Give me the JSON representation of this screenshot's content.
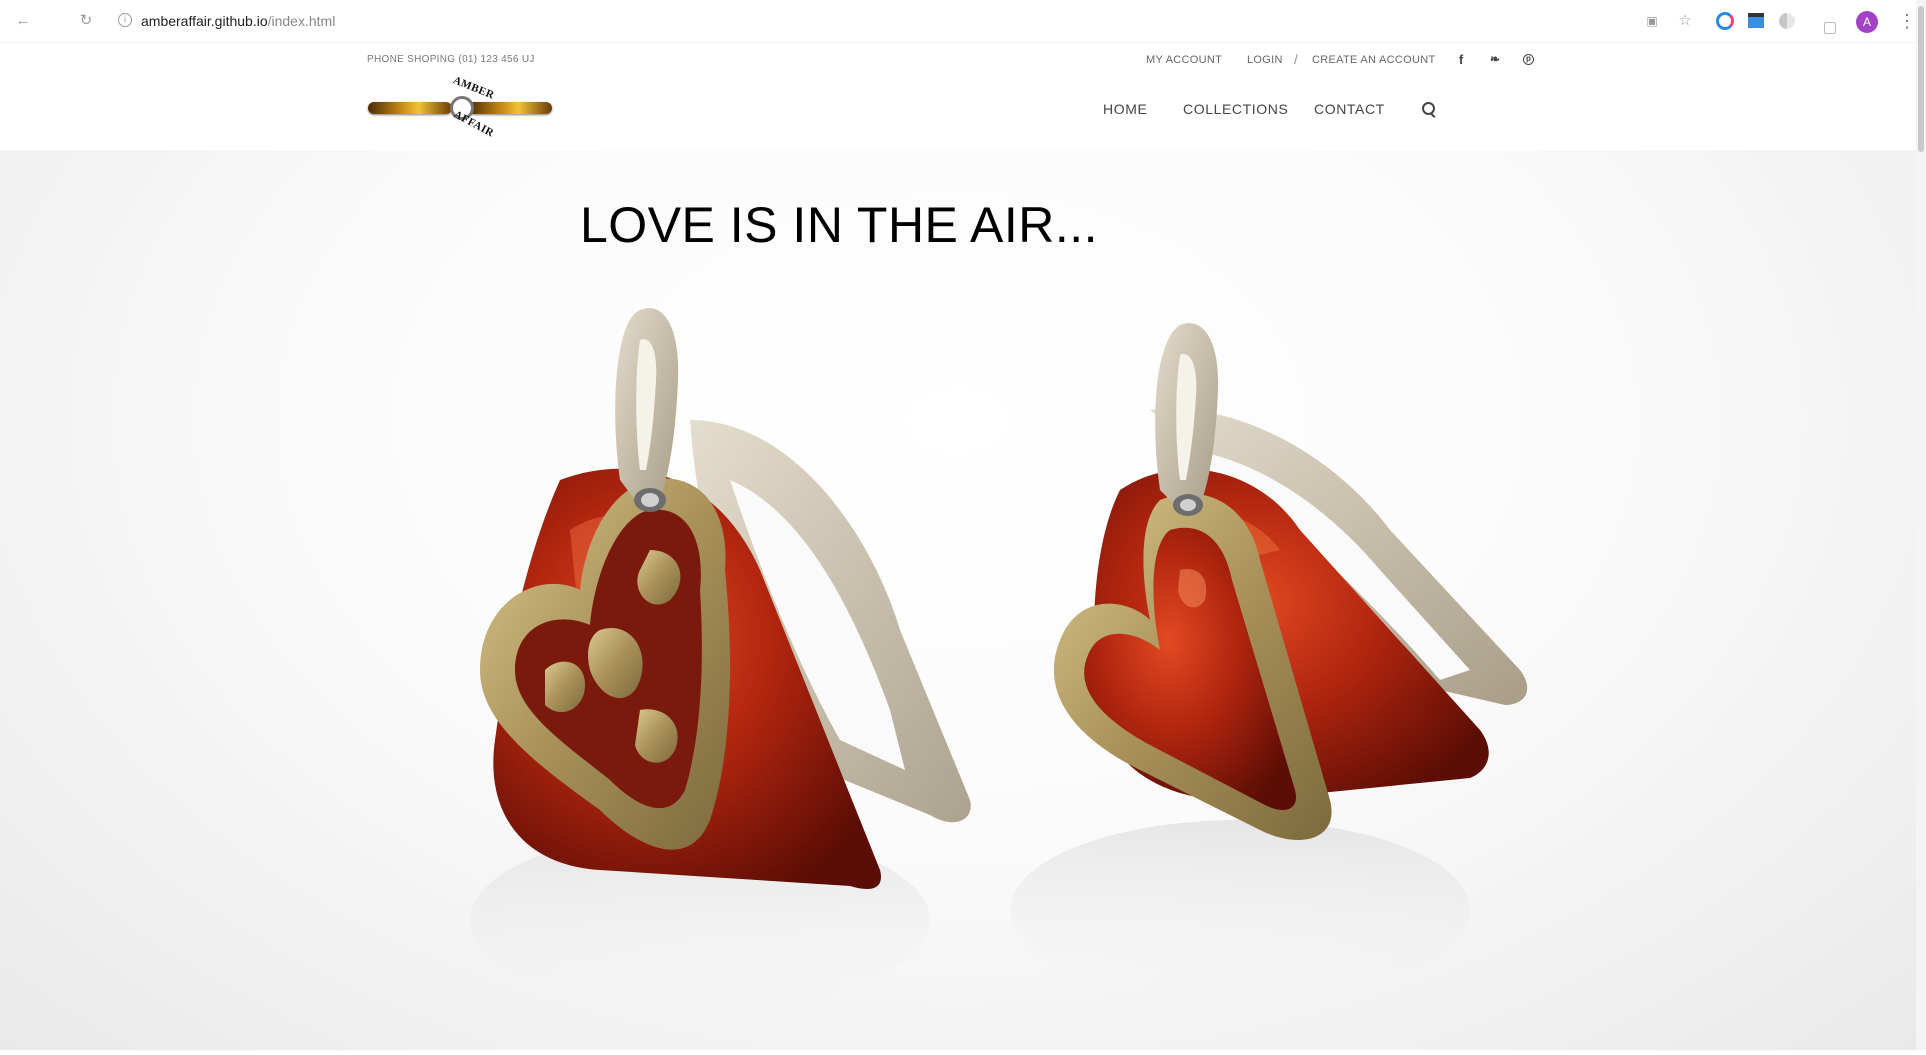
{
  "browser": {
    "url_host": "amberaffair.github.io",
    "url_path": "/index.html",
    "avatar_letter": "A",
    "icons": [
      "back-arrow-icon",
      "reload-icon",
      "info-icon",
      "translate-icon",
      "star-icon",
      "extension-icons",
      "menu-kebab-icon"
    ]
  },
  "header": {
    "phone": "PHONE SHOPING (01) 123 456 UJ",
    "top_links": {
      "my_account": "MY ACCOUNT",
      "login": "LOGIN",
      "separator": "/",
      "create_account": "CREATE AN ACCOUNT"
    },
    "social": [
      "facebook-icon",
      "twitter-icon",
      "pinterest-icon"
    ],
    "nav": {
      "home": "HOME",
      "collections": "COLLECTIONS",
      "contact": "CONTACT"
    },
    "logo": {
      "word_top": "AMBER",
      "word_bottom": "AFFAIR"
    }
  },
  "hero": {
    "headline": "LOVE IS IN THE AIR...",
    "image": "two amber heart pendants with silver bails"
  },
  "colors": {
    "amber": "#8e1a0a",
    "amber_light": "#d6431c",
    "gold": "#b9a46a",
    "silver": "#c9bfa9",
    "avatar": "#a142c7"
  }
}
